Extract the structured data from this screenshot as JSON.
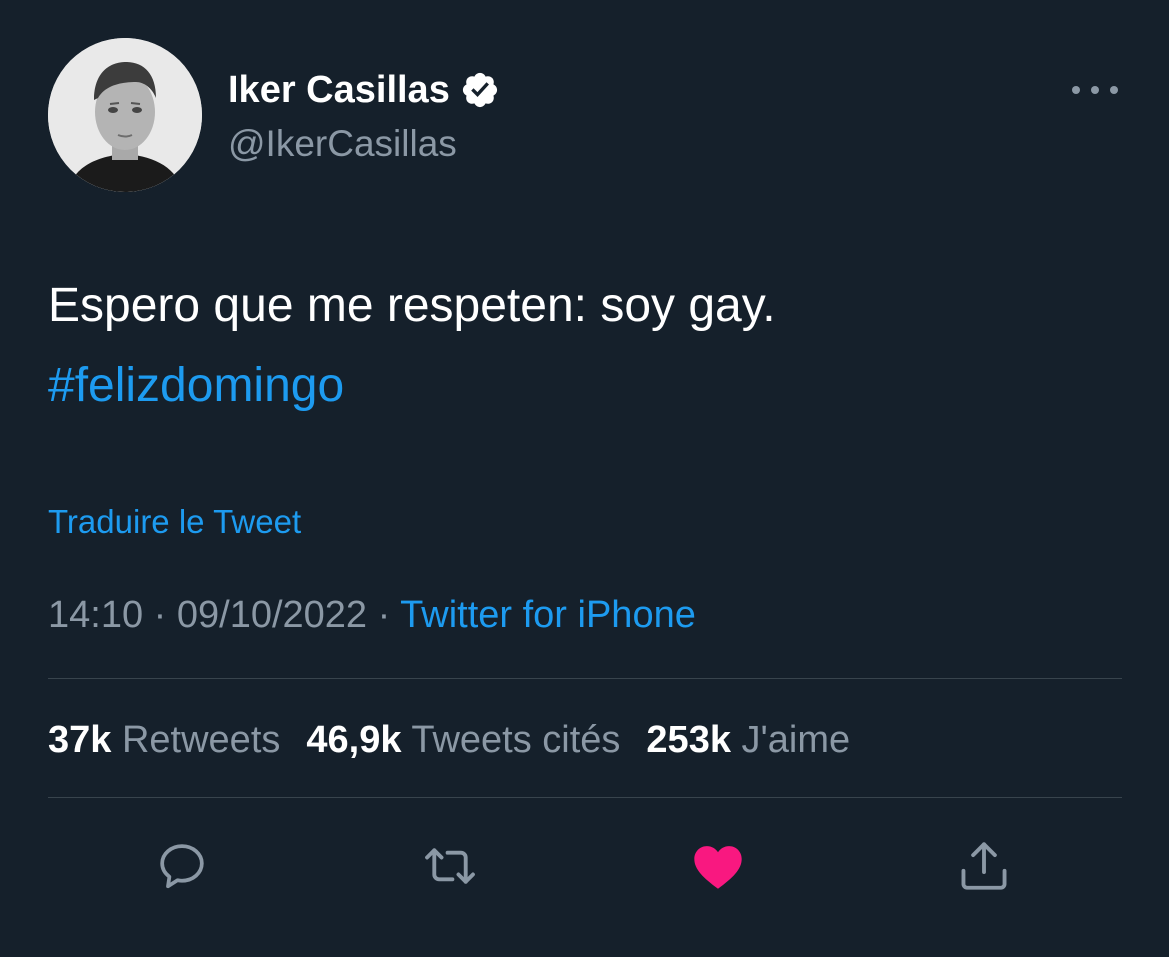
{
  "user": {
    "display_name": "Iker Casillas",
    "handle": "@IkerCasillas",
    "verified": true
  },
  "tweet": {
    "text": "Espero que me respeten: soy gay.",
    "hashtag": "#felizdomingo",
    "translate_label": "Traduire le Tweet",
    "time": "14:10",
    "separator": " · ",
    "date": "09/10/2022",
    "source": "Twitter for iPhone"
  },
  "stats": {
    "retweets_count": "37k",
    "retweets_label": "Retweets",
    "quotes_count": "46,9k",
    "quotes_label": "Tweets cités",
    "likes_count": "253k",
    "likes_label": "J'aime"
  },
  "actions": {
    "reply": "reply-icon",
    "retweet": "retweet-icon",
    "like": "heart-icon",
    "share": "share-icon",
    "liked": true
  },
  "colors": {
    "background": "#15202b",
    "accent": "#1d9bf0",
    "muted": "#8b98a5",
    "like": "#f91880",
    "divider": "#38444d"
  }
}
